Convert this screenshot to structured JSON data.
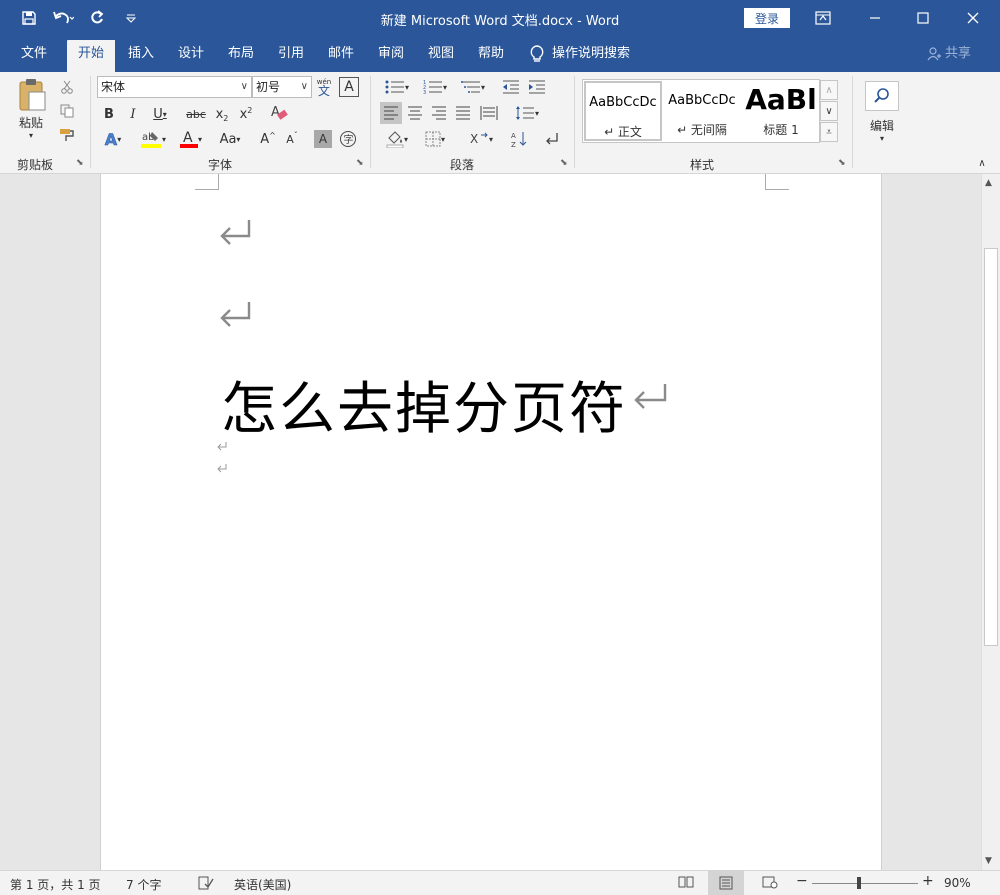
{
  "window": {
    "title": "新建 Microsoft Word 文档.docx  -  Word",
    "login_label": "登录"
  },
  "tabs": [
    {
      "label": "文件"
    },
    {
      "label": "开始"
    },
    {
      "label": "插入"
    },
    {
      "label": "设计"
    },
    {
      "label": "布局"
    },
    {
      "label": "引用"
    },
    {
      "label": "邮件"
    },
    {
      "label": "审阅"
    },
    {
      "label": "视图"
    },
    {
      "label": "帮助"
    }
  ],
  "active_tab": "开始",
  "tell_me": "操作说明搜索",
  "share_label": "共享",
  "ribbon": {
    "clipboard": {
      "label": "剪贴板",
      "paste_label": "粘贴"
    },
    "font": {
      "label": "字体",
      "font_name": "宋体",
      "font_size": "初号",
      "phonetic_top": "wén",
      "phonetic_bottom": "文"
    },
    "paragraph": {
      "label": "段落"
    },
    "styles": {
      "label": "样式",
      "items": [
        {
          "preview": "AaBbCcDc",
          "name": "↵ 正文"
        },
        {
          "preview": "AaBbCcDc",
          "name": "↵ 无间隔"
        },
        {
          "preview": "AaBl",
          "name": "标题 1"
        }
      ]
    },
    "editing": {
      "label": "编辑"
    }
  },
  "document": {
    "heading": "怎么去掉分页符"
  },
  "status": {
    "page": "第 1 页，共 1 页",
    "words": "7 个字",
    "language": "英语(美国)",
    "zoom": "90%",
    "zoom_percent": 90
  },
  "colors": {
    "title_bg": "#2b579a",
    "highlight": "#ffff00",
    "font_color": "#ff0000"
  }
}
